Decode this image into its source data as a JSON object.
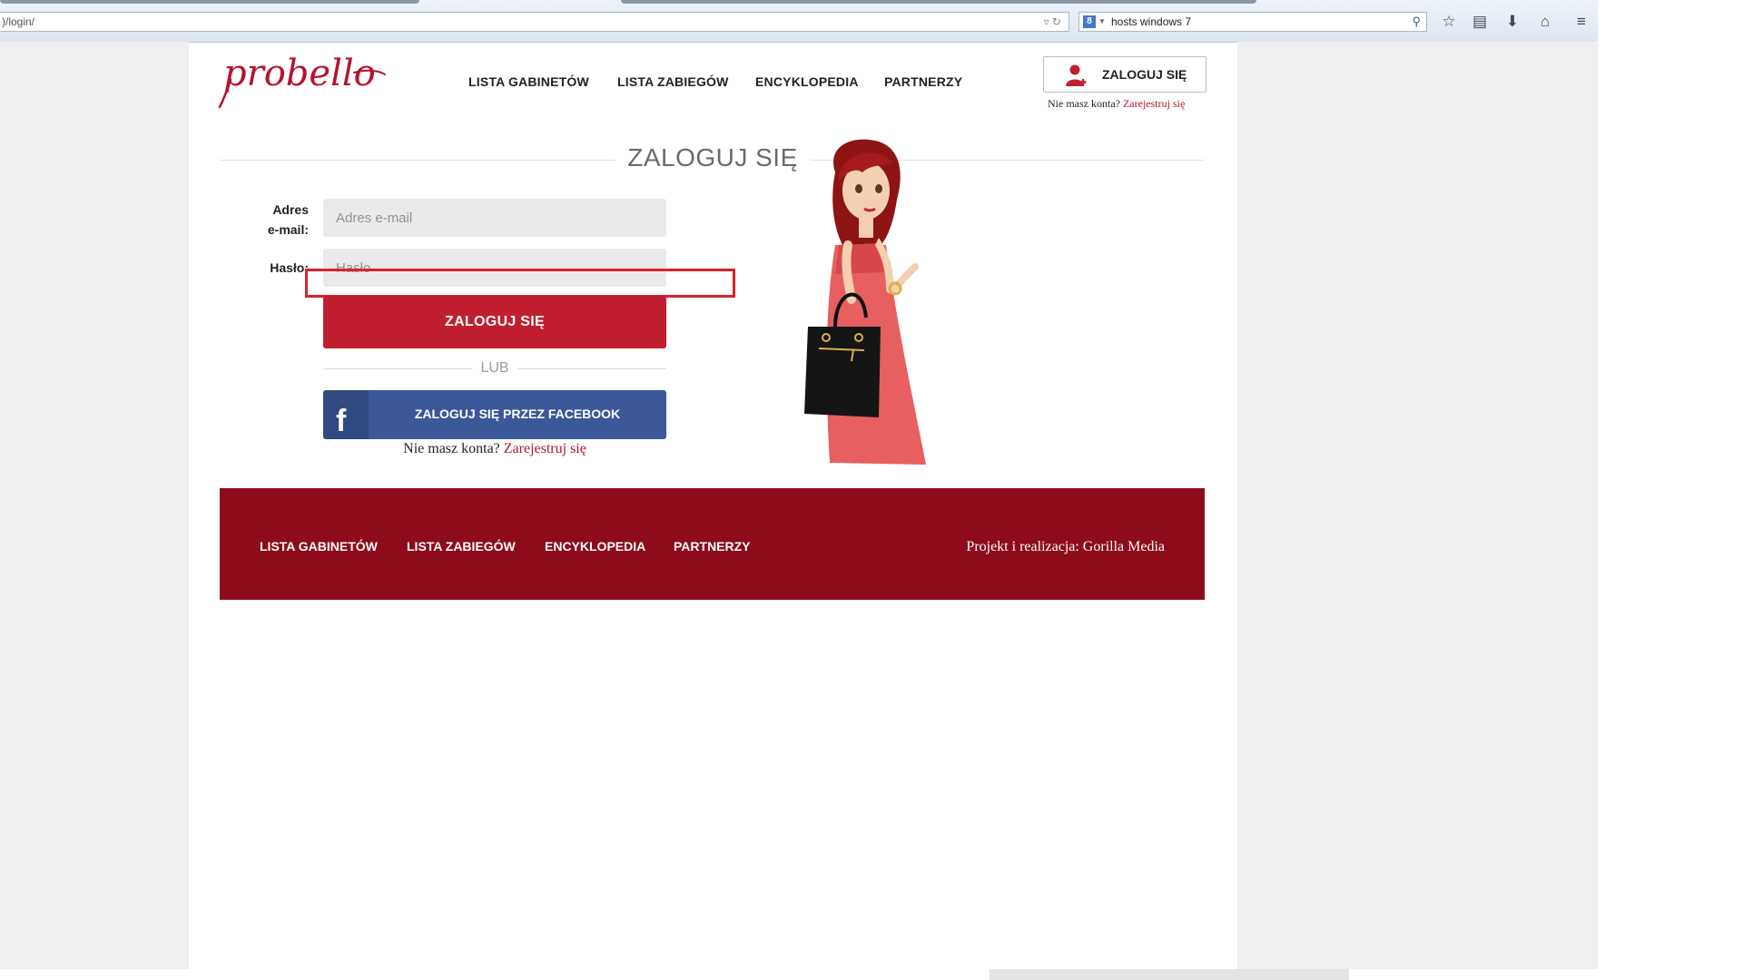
{
  "browser": {
    "url": ")/login/",
    "search_query": "hosts windows 7",
    "search_engine_icon": "8"
  },
  "header": {
    "logo_text": "probello",
    "nav": [
      "LISTA GABINETÓW",
      "LISTA ZABIEGÓW",
      "ENCYKLOPEDIA",
      "PARTNERZY"
    ],
    "login_button": "ZALOGUJ SIĘ",
    "no_account": "Nie masz konta?",
    "register_link": "Zarejestruj się"
  },
  "login": {
    "title": "ZALOGUJ SIĘ",
    "email_label_line1": "Adres",
    "email_label_line2": "e-mail:",
    "email_placeholder": "Adres e-mail",
    "password_label": "Hasło:",
    "password_placeholder": "Hasło",
    "submit": "ZALOGUJ SIĘ",
    "or": "LUB",
    "facebook_button": "ZALOGUJ SIĘ PRZEZ FACEBOOK",
    "no_account": "Nie masz konta?",
    "register_link": "Zarejestruj się"
  },
  "footer": {
    "nav": [
      "LISTA GABINETÓW",
      "LISTA ZABIEGÓW",
      "ENCYKLOPEDIA",
      "PARTNERZY"
    ],
    "credit": "Projekt i realizacja: Gorilla Media"
  },
  "colors": {
    "brand_red": "#c11f2f",
    "footer_red": "#8e0b1c",
    "facebook_blue": "#3b5998",
    "annotation_red": "#d8222b"
  }
}
